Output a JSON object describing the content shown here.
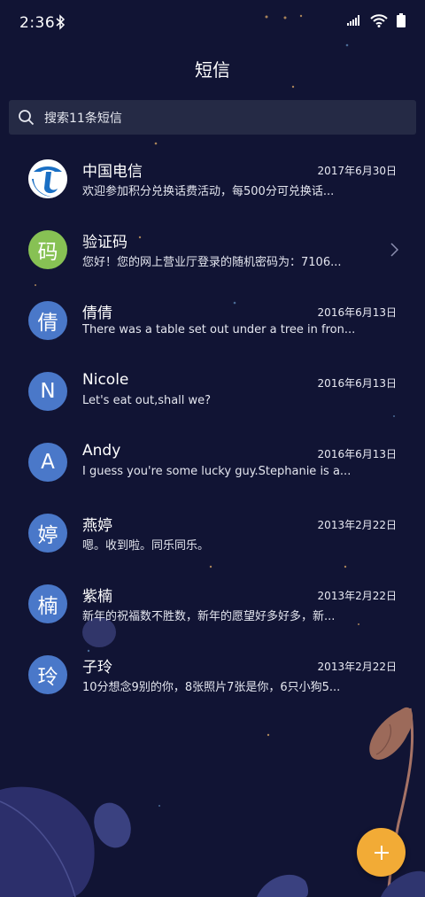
{
  "status_bar": {
    "time": "2:36"
  },
  "header": {
    "title": "短信"
  },
  "search": {
    "placeholder": "搜索11条短信"
  },
  "conversations": [
    {
      "name": "中国电信",
      "date": "2017年6月30日",
      "preview": "欢迎参加积分兑换话费活动，每500分可兑换话...",
      "avatar_text": "",
      "avatar_icon": "china-telecom-logo-icon"
    },
    {
      "name": "验证码",
      "date": "",
      "preview": "您好！您的网上营业厅登录的随机密码为：7106...",
      "avatar_text": "码"
    },
    {
      "name": "倩倩",
      "date": "2016年6月13日",
      "preview": "There was a table set out under a tree in fron...",
      "avatar_text": "倩"
    },
    {
      "name": "Nicole",
      "date": "2016年6月13日",
      "preview": "Let's eat out,shall we?",
      "avatar_text": "N"
    },
    {
      "name": "Andy",
      "date": "2016年6月13日",
      "preview": "I guess you're some lucky guy.Stephanie is a...",
      "avatar_text": "A"
    },
    {
      "name": "燕婷",
      "date": "2013年2月22日",
      "preview": "嗯。收到啦。同乐同乐。",
      "avatar_text": "婷"
    },
    {
      "name": "紫楠",
      "date": "2013年2月22日",
      "preview": "新年的祝福数不胜数，新年的愿望好多好多，新...",
      "avatar_text": "楠"
    },
    {
      "name": "子玲",
      "date": "2013年2月22日",
      "preview": "10分想念9别的你，8张照片7张是你，6只小狗5...",
      "avatar_text": "玲"
    }
  ],
  "colors": {
    "background": "#111434",
    "avatar_blue": "#4a78c9",
    "avatar_green": "#87c154",
    "fab": "#f2ab36"
  },
  "fab": {
    "icon": "plus-icon"
  }
}
